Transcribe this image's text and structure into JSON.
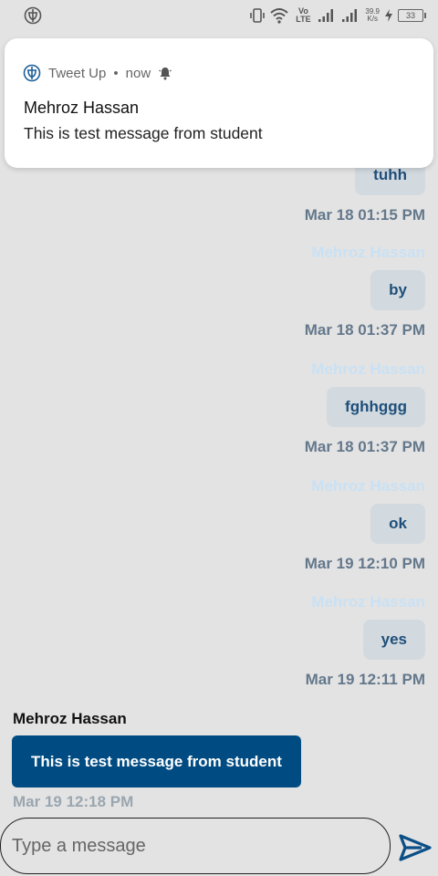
{
  "status_bar": {
    "network_tag": "Vo LTE",
    "net_speed_value": "39.9",
    "net_speed_unit": "K/s",
    "battery": "33"
  },
  "notification": {
    "app_name": "Tweet Up",
    "time": "now",
    "title": "Mehroz Hassan",
    "body": "This is test message from student"
  },
  "outgoing_messages": [
    {
      "sender": "",
      "text": "tuhh",
      "time": "Mar 18 01:15 PM"
    },
    {
      "sender": "Mehroz Hassan",
      "text": "by",
      "time": "Mar 18 01:37 PM"
    },
    {
      "sender": "Mehroz Hassan",
      "text": "fghhggg",
      "time": "Mar 18 01:37 PM"
    },
    {
      "sender": "Mehroz Hassan",
      "text": "ok",
      "time": "Mar 19 12:10 PM"
    },
    {
      "sender": "Mehroz Hassan",
      "text": "yes",
      "time": "Mar 19 12:11 PM"
    }
  ],
  "incoming_message": {
    "sender": "Mehroz Hassan",
    "text": "This is test message from student",
    "time": "Mar 19 12:18 PM"
  },
  "composer": {
    "placeholder": "Type a message",
    "value": ""
  },
  "icons": {
    "app": "tweet-up-logo-icon",
    "vibrate": "vibrate-icon",
    "wifi": "wifi-icon",
    "signal": "signal-icon",
    "charging": "charging-icon",
    "alert": "alert-bell-icon",
    "send": "send-icon"
  },
  "colors": {
    "background": "#e3e3e3",
    "incoming_bubble": "#004c82",
    "outgoing_bubble": "#d2dae0",
    "outgoing_text": "#1e4e79",
    "send_icon": "#0b4f87"
  }
}
